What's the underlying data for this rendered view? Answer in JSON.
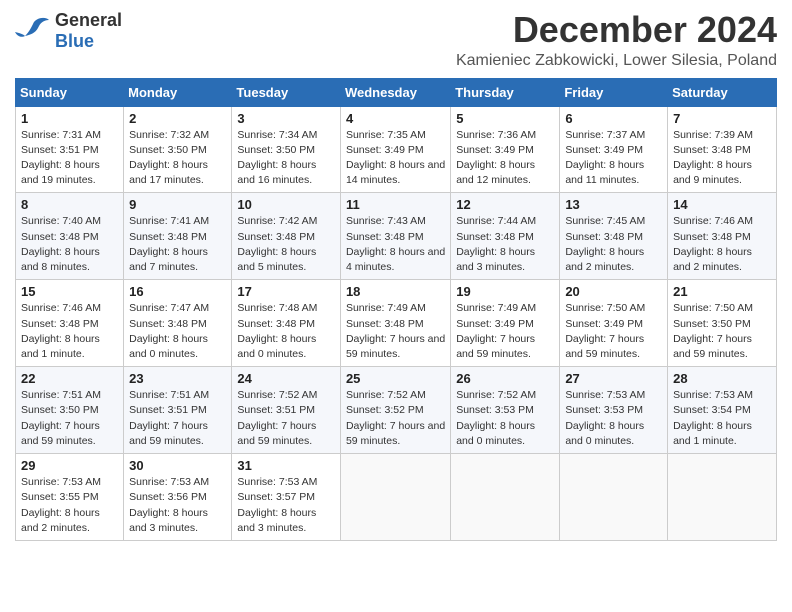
{
  "header": {
    "logo_general": "General",
    "logo_blue": "Blue",
    "title": "December 2024",
    "location": "Kamieniec Zabkowicki, Lower Silesia, Poland"
  },
  "calendar": {
    "weekdays": [
      "Sunday",
      "Monday",
      "Tuesday",
      "Wednesday",
      "Thursday",
      "Friday",
      "Saturday"
    ],
    "weeks": [
      [
        {
          "day": "1",
          "sunrise": "7:31 AM",
          "sunset": "3:51 PM",
          "daylight": "8 hours and 19 minutes."
        },
        {
          "day": "2",
          "sunrise": "7:32 AM",
          "sunset": "3:50 PM",
          "daylight": "8 hours and 17 minutes."
        },
        {
          "day": "3",
          "sunrise": "7:34 AM",
          "sunset": "3:50 PM",
          "daylight": "8 hours and 16 minutes."
        },
        {
          "day": "4",
          "sunrise": "7:35 AM",
          "sunset": "3:49 PM",
          "daylight": "8 hours and 14 minutes."
        },
        {
          "day": "5",
          "sunrise": "7:36 AM",
          "sunset": "3:49 PM",
          "daylight": "8 hours and 12 minutes."
        },
        {
          "day": "6",
          "sunrise": "7:37 AM",
          "sunset": "3:49 PM",
          "daylight": "8 hours and 11 minutes."
        },
        {
          "day": "7",
          "sunrise": "7:39 AM",
          "sunset": "3:48 PM",
          "daylight": "8 hours and 9 minutes."
        }
      ],
      [
        {
          "day": "8",
          "sunrise": "7:40 AM",
          "sunset": "3:48 PM",
          "daylight": "8 hours and 8 minutes."
        },
        {
          "day": "9",
          "sunrise": "7:41 AM",
          "sunset": "3:48 PM",
          "daylight": "8 hours and 7 minutes."
        },
        {
          "day": "10",
          "sunrise": "7:42 AM",
          "sunset": "3:48 PM",
          "daylight": "8 hours and 5 minutes."
        },
        {
          "day": "11",
          "sunrise": "7:43 AM",
          "sunset": "3:48 PM",
          "daylight": "8 hours and 4 minutes."
        },
        {
          "day": "12",
          "sunrise": "7:44 AM",
          "sunset": "3:48 PM",
          "daylight": "8 hours and 3 minutes."
        },
        {
          "day": "13",
          "sunrise": "7:45 AM",
          "sunset": "3:48 PM",
          "daylight": "8 hours and 2 minutes."
        },
        {
          "day": "14",
          "sunrise": "7:46 AM",
          "sunset": "3:48 PM",
          "daylight": "8 hours and 2 minutes."
        }
      ],
      [
        {
          "day": "15",
          "sunrise": "7:46 AM",
          "sunset": "3:48 PM",
          "daylight": "8 hours and 1 minute."
        },
        {
          "day": "16",
          "sunrise": "7:47 AM",
          "sunset": "3:48 PM",
          "daylight": "8 hours and 0 minutes."
        },
        {
          "day": "17",
          "sunrise": "7:48 AM",
          "sunset": "3:48 PM",
          "daylight": "8 hours and 0 minutes."
        },
        {
          "day": "18",
          "sunrise": "7:49 AM",
          "sunset": "3:48 PM",
          "daylight": "7 hours and 59 minutes."
        },
        {
          "day": "19",
          "sunrise": "7:49 AM",
          "sunset": "3:49 PM",
          "daylight": "7 hours and 59 minutes."
        },
        {
          "day": "20",
          "sunrise": "7:50 AM",
          "sunset": "3:49 PM",
          "daylight": "7 hours and 59 minutes."
        },
        {
          "day": "21",
          "sunrise": "7:50 AM",
          "sunset": "3:50 PM",
          "daylight": "7 hours and 59 minutes."
        }
      ],
      [
        {
          "day": "22",
          "sunrise": "7:51 AM",
          "sunset": "3:50 PM",
          "daylight": "7 hours and 59 minutes."
        },
        {
          "day": "23",
          "sunrise": "7:51 AM",
          "sunset": "3:51 PM",
          "daylight": "7 hours and 59 minutes."
        },
        {
          "day": "24",
          "sunrise": "7:52 AM",
          "sunset": "3:51 PM",
          "daylight": "7 hours and 59 minutes."
        },
        {
          "day": "25",
          "sunrise": "7:52 AM",
          "sunset": "3:52 PM",
          "daylight": "7 hours and 59 minutes."
        },
        {
          "day": "26",
          "sunrise": "7:52 AM",
          "sunset": "3:53 PM",
          "daylight": "8 hours and 0 minutes."
        },
        {
          "day": "27",
          "sunrise": "7:53 AM",
          "sunset": "3:53 PM",
          "daylight": "8 hours and 0 minutes."
        },
        {
          "day": "28",
          "sunrise": "7:53 AM",
          "sunset": "3:54 PM",
          "daylight": "8 hours and 1 minute."
        }
      ],
      [
        {
          "day": "29",
          "sunrise": "7:53 AM",
          "sunset": "3:55 PM",
          "daylight": "8 hours and 2 minutes."
        },
        {
          "day": "30",
          "sunrise": "7:53 AM",
          "sunset": "3:56 PM",
          "daylight": "8 hours and 3 minutes."
        },
        {
          "day": "31",
          "sunrise": "7:53 AM",
          "sunset": "3:57 PM",
          "daylight": "8 hours and 3 minutes."
        },
        null,
        null,
        null,
        null
      ]
    ]
  }
}
